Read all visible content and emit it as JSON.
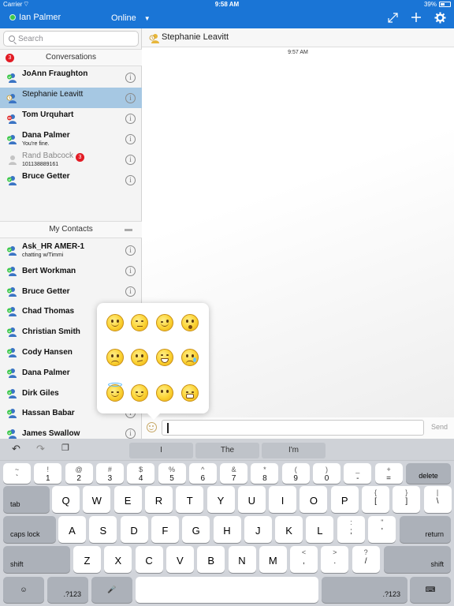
{
  "status_bar": {
    "carrier": "Carrier",
    "time": "9:58 AM",
    "battery": "39%"
  },
  "header": {
    "user_name": "Ian Palmer",
    "presence": "Online"
  },
  "search": {
    "placeholder": "Search"
  },
  "conversations": {
    "title": "Conversations",
    "unread": "3",
    "items": [
      {
        "name": "JoAnn Fraughton",
        "sub": "",
        "status": "available"
      },
      {
        "name": "Stephanie Leavitt",
        "sub": "",
        "status": "away"
      },
      {
        "name": "Tom Urquhart",
        "sub": "",
        "status": "busy"
      },
      {
        "name": "Dana Palmer",
        "sub": "You're fine.",
        "status": "available"
      },
      {
        "name": "Rand Babcock",
        "sub": "101138889161",
        "status": "offline",
        "badge": "3"
      },
      {
        "name": "Bruce Getter",
        "sub": "",
        "status": "available"
      }
    ]
  },
  "contacts": {
    "title": "My Contacts",
    "items": [
      {
        "name": "Ask_HR AMER-1",
        "sub": "chatting w/Timmi"
      },
      {
        "name": "Bert Workman",
        "sub": ""
      },
      {
        "name": "Bruce Getter",
        "sub": ""
      },
      {
        "name": "Chad Thomas",
        "sub": ""
      },
      {
        "name": "Christian Smith",
        "sub": ""
      },
      {
        "name": "Cody Hansen",
        "sub": ""
      },
      {
        "name": "Dana Palmer",
        "sub": ""
      },
      {
        "name": "Dirk Giles",
        "sub": ""
      },
      {
        "name": "Hassan Babar",
        "sub": ""
      },
      {
        "name": "James Swallow",
        "sub": ""
      }
    ]
  },
  "chat": {
    "title": "Stephanie Leavitt",
    "timestamp": "9:57 AM",
    "send_label": "Send"
  },
  "keyboard": {
    "suggestions": [
      "I",
      "The",
      "I'm"
    ],
    "row1": [
      [
        "~",
        "`"
      ],
      [
        "!",
        "1"
      ],
      [
        "@",
        "2"
      ],
      [
        "#",
        "3"
      ],
      [
        "$",
        "4"
      ],
      [
        "%",
        "5"
      ],
      [
        "^",
        "6"
      ],
      [
        "&",
        "7"
      ],
      [
        "*",
        "8"
      ],
      [
        "(",
        "9"
      ],
      [
        ")",
        "0"
      ],
      [
        "_",
        "-"
      ],
      [
        "+",
        "="
      ]
    ],
    "delete": "delete",
    "tab": "tab",
    "row2": [
      "Q",
      "W",
      "E",
      "R",
      "T",
      "Y",
      "U",
      "I",
      "O",
      "P"
    ],
    "row2_sym": [
      [
        "{",
        "["
      ],
      [
        "}",
        "]"
      ],
      [
        "|",
        "\\"
      ]
    ],
    "caps": "caps lock",
    "row3": [
      "A",
      "S",
      "D",
      "F",
      "G",
      "H",
      "J",
      "K",
      "L"
    ],
    "row3_sym": [
      [
        ":",
        ";"
      ],
      [
        "\"",
        "'"
      ]
    ],
    "return": "return",
    "shift": "shift",
    "row4": [
      "Z",
      "X",
      "C",
      "V",
      "B",
      "N",
      "M"
    ],
    "row4_sym": [
      [
        "<",
        ","
      ],
      [
        ">",
        "."
      ],
      [
        "?",
        "/"
      ]
    ],
    "num_label": ".?123"
  },
  "colors": {
    "brand": "#1a75d6",
    "selected_row": "#a6c8e3",
    "badge": "#e21b24",
    "available": "#3cc84a",
    "away": "#e7b63a",
    "busy": "#e23a3a",
    "offline": "#c4c4c4"
  }
}
